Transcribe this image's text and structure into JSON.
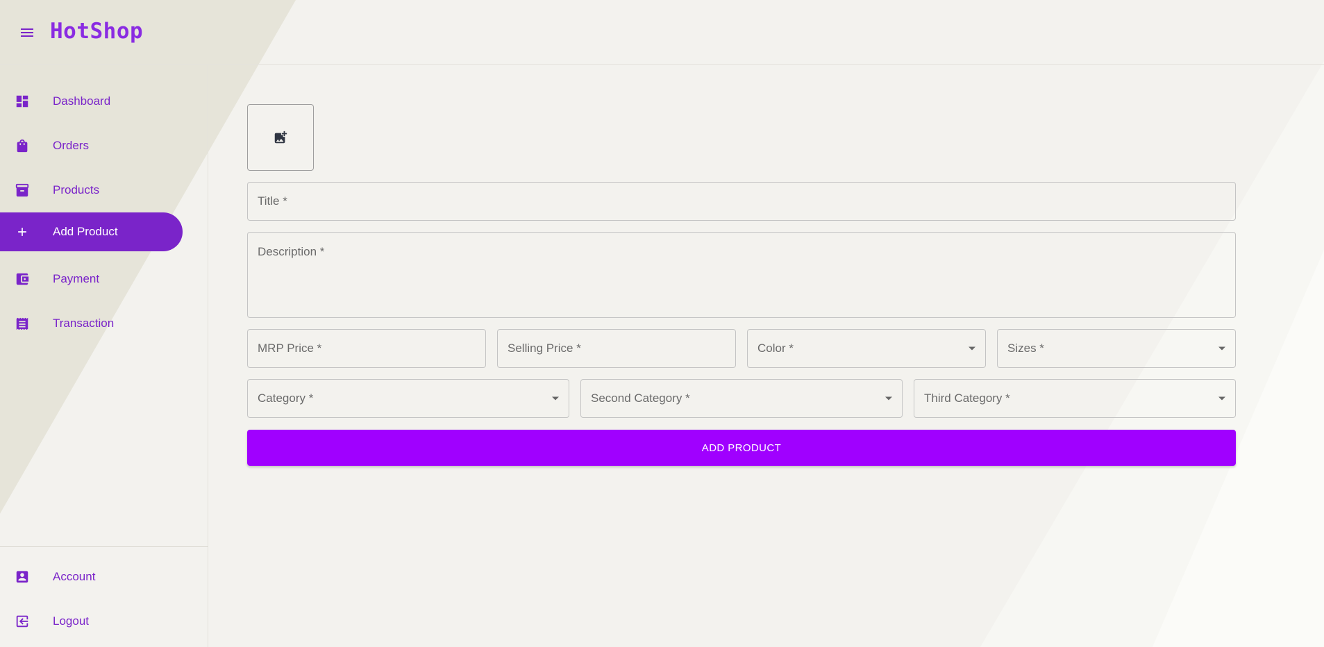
{
  "app": {
    "brand": "HotShop"
  },
  "colors": {
    "accent": "#7a24c9",
    "button": "#a000ff"
  },
  "nav": {
    "items": [
      {
        "label": "Dashboard",
        "icon": "dashboard-icon"
      },
      {
        "label": "Orders",
        "icon": "shopping-bag-icon"
      },
      {
        "label": "Products",
        "icon": "inventory-icon"
      },
      {
        "label": "Add Product",
        "icon": "add-icon",
        "active": true
      },
      {
        "label": "Payment",
        "icon": "wallet-icon"
      },
      {
        "label": "Transaction",
        "icon": "receipt-icon"
      }
    ],
    "bottom": [
      {
        "label": "Account",
        "icon": "account-box-icon"
      },
      {
        "label": "Logout",
        "icon": "logout-icon"
      }
    ]
  },
  "form": {
    "upload_icon": "add-photo-icon",
    "title_placeholder": "Title *",
    "description_placeholder": "Description *",
    "mrp_placeholder": "MRP Price *",
    "selling_placeholder": "Selling Price *",
    "color_label": "Color *",
    "sizes_label": "Sizes *",
    "category_label": "Category *",
    "second_category_label": "Second Category *",
    "third_category_label": "Third Category *",
    "submit_label": "ADD PRODUCT"
  }
}
